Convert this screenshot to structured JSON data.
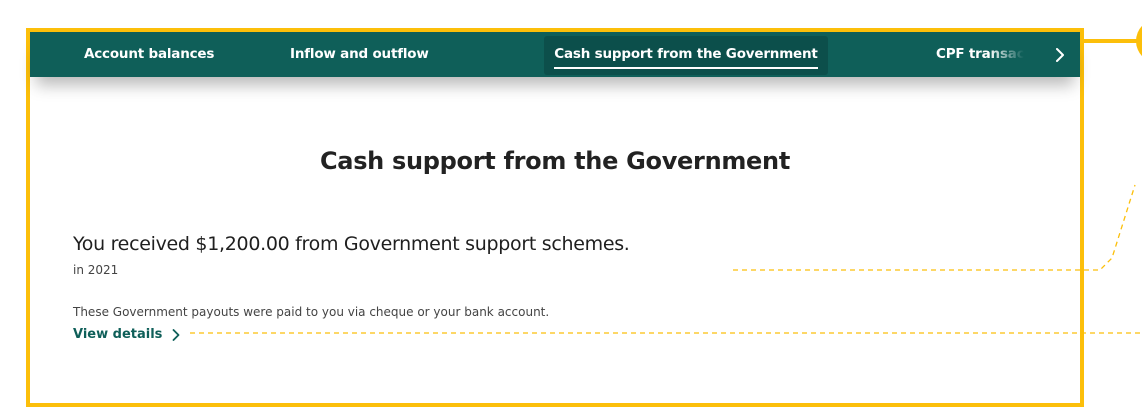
{
  "tabs": [
    {
      "label": "Account balances"
    },
    {
      "label": "Inflow and outflow"
    },
    {
      "label": "Cash support from the Government"
    },
    {
      "label": "CPF transactions"
    }
  ],
  "main": {
    "title": "Cash support from the Government",
    "headline": "You received $1,200.00 from Government support schemes.",
    "year": "in 2021",
    "description": "These Government payouts were paid to you via cheque or your bank account.",
    "view_details": "View details"
  },
  "icons": {
    "scroll_right": "chevron-right-icon",
    "view_details": "chevron-right-icon"
  },
  "colors": {
    "tab_bar": "#0f5f59",
    "active_tab": "#0c4f4b",
    "accent": "#0f5f59",
    "annotation": "#fcbf0a",
    "text": "#222222"
  }
}
